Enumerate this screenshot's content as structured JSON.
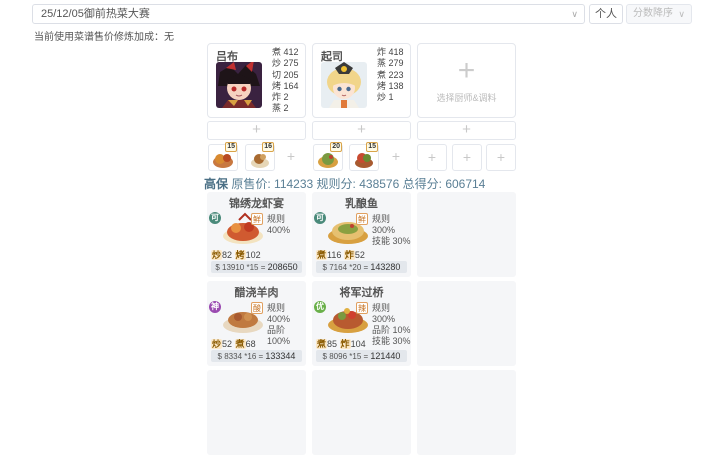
{
  "header": {
    "contest_select": "25/12/05御前热菜大赛",
    "solo_button": "个人",
    "sort_button": "分数降序",
    "chevron": "chevron-down-icon"
  },
  "note": "当前使用菜谱售价修炼加成：无",
  "chefs": [
    {
      "name": "吕布",
      "skills": [
        "煮 412",
        "炒 275",
        "切 205",
        "烤 164",
        "炸 2",
        "蒸 2"
      ]
    },
    {
      "name": "起司",
      "skills": [
        "炸 418",
        "蒸 279",
        "煮 223",
        "烤 138",
        "炒 1"
      ]
    },
    {
      "empty_label": "选择厨师&调料"
    }
  ],
  "slot_plus": "+",
  "items": [
    {
      "badge": "15"
    },
    {
      "badge": "16"
    },
    {
      "badge": "20"
    },
    {
      "badge": "15"
    }
  ],
  "summary": {
    "grade": "高保",
    "orig_label": "原售价:",
    "orig_value": "114233",
    "rule_label": "规则分:",
    "rule_value": "438576",
    "total_label": "总得分:",
    "total_value": "606714"
  },
  "dishes": [
    {
      "name": "锦绣龙虾宴",
      "tag": "可",
      "tag_color": "#4a8a7a",
      "cond": "鲜",
      "rules": [
        "规则 400%"
      ],
      "need": [
        [
          "炒",
          "82"
        ],
        [
          "烤",
          "102"
        ]
      ],
      "price": "13910 *15",
      "total": "208650"
    },
    {
      "name": "乳酿鱼",
      "tag": "可",
      "tag_color": "#4a8a7a",
      "cond": "鲜",
      "rules": [
        "规则 300%",
        "技能 30%"
      ],
      "need": [
        [
          "煮",
          "116"
        ],
        [
          "炸",
          "52"
        ]
      ],
      "price": "7164 *20",
      "total": "143280"
    },
    {
      "name": "醋浇羊肉",
      "tag": "神",
      "tag_color": "#9a4ab0",
      "cond": "酸",
      "rules": [
        "规则 400%",
        "品阶 100%"
      ],
      "need": [
        [
          "炒",
          "52"
        ],
        [
          "煮",
          "68"
        ]
      ],
      "price": "8334 *16",
      "total": "133344"
    },
    {
      "name": "将军过桥",
      "tag": "优",
      "tag_color": "#6ab04a",
      "cond": "辣",
      "rules": [
        "规则 300%",
        "品阶 10%",
        "技能 30%"
      ],
      "need": [
        [
          "煮",
          "85"
        ],
        [
          "炸",
          "104"
        ]
      ],
      "price": "8096 *15",
      "total": "121440"
    }
  ],
  "currency": "$",
  "equals": "="
}
